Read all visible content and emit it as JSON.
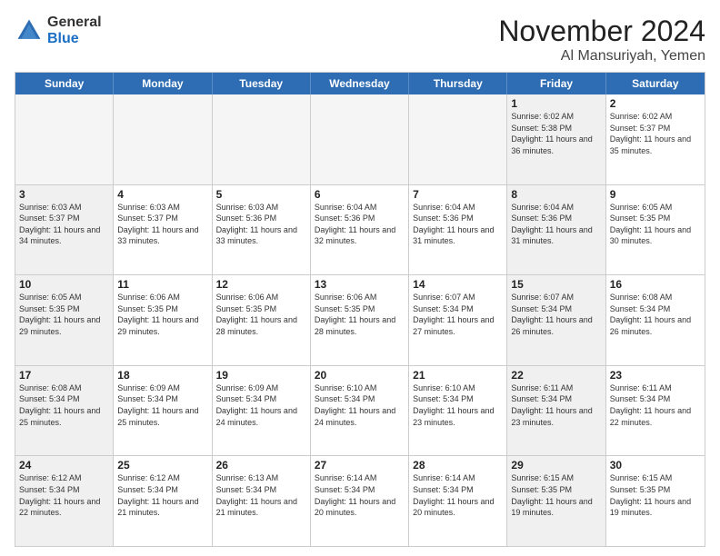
{
  "header": {
    "logo_general": "General",
    "logo_blue": "Blue",
    "month": "November 2024",
    "location": "Al Mansuriyah, Yemen"
  },
  "weekdays": [
    "Sunday",
    "Monday",
    "Tuesday",
    "Wednesday",
    "Thursday",
    "Friday",
    "Saturday"
  ],
  "rows": [
    [
      {
        "day": "",
        "info": "",
        "empty": true
      },
      {
        "day": "",
        "info": "",
        "empty": true
      },
      {
        "day": "",
        "info": "",
        "empty": true
      },
      {
        "day": "",
        "info": "",
        "empty": true
      },
      {
        "day": "",
        "info": "",
        "empty": true
      },
      {
        "day": "1",
        "info": "Sunrise: 6:02 AM\nSunset: 5:38 PM\nDaylight: 11 hours\nand 36 minutes.",
        "shaded": true
      },
      {
        "day": "2",
        "info": "Sunrise: 6:02 AM\nSunset: 5:37 PM\nDaylight: 11 hours\nand 35 minutes.",
        "shaded": false
      }
    ],
    [
      {
        "day": "3",
        "info": "Sunrise: 6:03 AM\nSunset: 5:37 PM\nDaylight: 11 hours\nand 34 minutes.",
        "shaded": true
      },
      {
        "day": "4",
        "info": "Sunrise: 6:03 AM\nSunset: 5:37 PM\nDaylight: 11 hours\nand 33 minutes.",
        "shaded": false
      },
      {
        "day": "5",
        "info": "Sunrise: 6:03 AM\nSunset: 5:36 PM\nDaylight: 11 hours\nand 33 minutes.",
        "shaded": false
      },
      {
        "day": "6",
        "info": "Sunrise: 6:04 AM\nSunset: 5:36 PM\nDaylight: 11 hours\nand 32 minutes.",
        "shaded": false
      },
      {
        "day": "7",
        "info": "Sunrise: 6:04 AM\nSunset: 5:36 PM\nDaylight: 11 hours\nand 31 minutes.",
        "shaded": false
      },
      {
        "day": "8",
        "info": "Sunrise: 6:04 AM\nSunset: 5:36 PM\nDaylight: 11 hours\nand 31 minutes.",
        "shaded": true
      },
      {
        "day": "9",
        "info": "Sunrise: 6:05 AM\nSunset: 5:35 PM\nDaylight: 11 hours\nand 30 minutes.",
        "shaded": false
      }
    ],
    [
      {
        "day": "10",
        "info": "Sunrise: 6:05 AM\nSunset: 5:35 PM\nDaylight: 11 hours\nand 29 minutes.",
        "shaded": true
      },
      {
        "day": "11",
        "info": "Sunrise: 6:06 AM\nSunset: 5:35 PM\nDaylight: 11 hours\nand 29 minutes.",
        "shaded": false
      },
      {
        "day": "12",
        "info": "Sunrise: 6:06 AM\nSunset: 5:35 PM\nDaylight: 11 hours\nand 28 minutes.",
        "shaded": false
      },
      {
        "day": "13",
        "info": "Sunrise: 6:06 AM\nSunset: 5:35 PM\nDaylight: 11 hours\nand 28 minutes.",
        "shaded": false
      },
      {
        "day": "14",
        "info": "Sunrise: 6:07 AM\nSunset: 5:34 PM\nDaylight: 11 hours\nand 27 minutes.",
        "shaded": false
      },
      {
        "day": "15",
        "info": "Sunrise: 6:07 AM\nSunset: 5:34 PM\nDaylight: 11 hours\nand 26 minutes.",
        "shaded": true
      },
      {
        "day": "16",
        "info": "Sunrise: 6:08 AM\nSunset: 5:34 PM\nDaylight: 11 hours\nand 26 minutes.",
        "shaded": false
      }
    ],
    [
      {
        "day": "17",
        "info": "Sunrise: 6:08 AM\nSunset: 5:34 PM\nDaylight: 11 hours\nand 25 minutes.",
        "shaded": true
      },
      {
        "day": "18",
        "info": "Sunrise: 6:09 AM\nSunset: 5:34 PM\nDaylight: 11 hours\nand 25 minutes.",
        "shaded": false
      },
      {
        "day": "19",
        "info": "Sunrise: 6:09 AM\nSunset: 5:34 PM\nDaylight: 11 hours\nand 24 minutes.",
        "shaded": false
      },
      {
        "day": "20",
        "info": "Sunrise: 6:10 AM\nSunset: 5:34 PM\nDaylight: 11 hours\nand 24 minutes.",
        "shaded": false
      },
      {
        "day": "21",
        "info": "Sunrise: 6:10 AM\nSunset: 5:34 PM\nDaylight: 11 hours\nand 23 minutes.",
        "shaded": false
      },
      {
        "day": "22",
        "info": "Sunrise: 6:11 AM\nSunset: 5:34 PM\nDaylight: 11 hours\nand 23 minutes.",
        "shaded": true
      },
      {
        "day": "23",
        "info": "Sunrise: 6:11 AM\nSunset: 5:34 PM\nDaylight: 11 hours\nand 22 minutes.",
        "shaded": false
      }
    ],
    [
      {
        "day": "24",
        "info": "Sunrise: 6:12 AM\nSunset: 5:34 PM\nDaylight: 11 hours\nand 22 minutes.",
        "shaded": true
      },
      {
        "day": "25",
        "info": "Sunrise: 6:12 AM\nSunset: 5:34 PM\nDaylight: 11 hours\nand 21 minutes.",
        "shaded": false
      },
      {
        "day": "26",
        "info": "Sunrise: 6:13 AM\nSunset: 5:34 PM\nDaylight: 11 hours\nand 21 minutes.",
        "shaded": false
      },
      {
        "day": "27",
        "info": "Sunrise: 6:14 AM\nSunset: 5:34 PM\nDaylight: 11 hours\nand 20 minutes.",
        "shaded": false
      },
      {
        "day": "28",
        "info": "Sunrise: 6:14 AM\nSunset: 5:34 PM\nDaylight: 11 hours\nand 20 minutes.",
        "shaded": false
      },
      {
        "day": "29",
        "info": "Sunrise: 6:15 AM\nSunset: 5:35 PM\nDaylight: 11 hours\nand 19 minutes.",
        "shaded": true
      },
      {
        "day": "30",
        "info": "Sunrise: 6:15 AM\nSunset: 5:35 PM\nDaylight: 11 hours\nand 19 minutes.",
        "shaded": false
      }
    ]
  ]
}
